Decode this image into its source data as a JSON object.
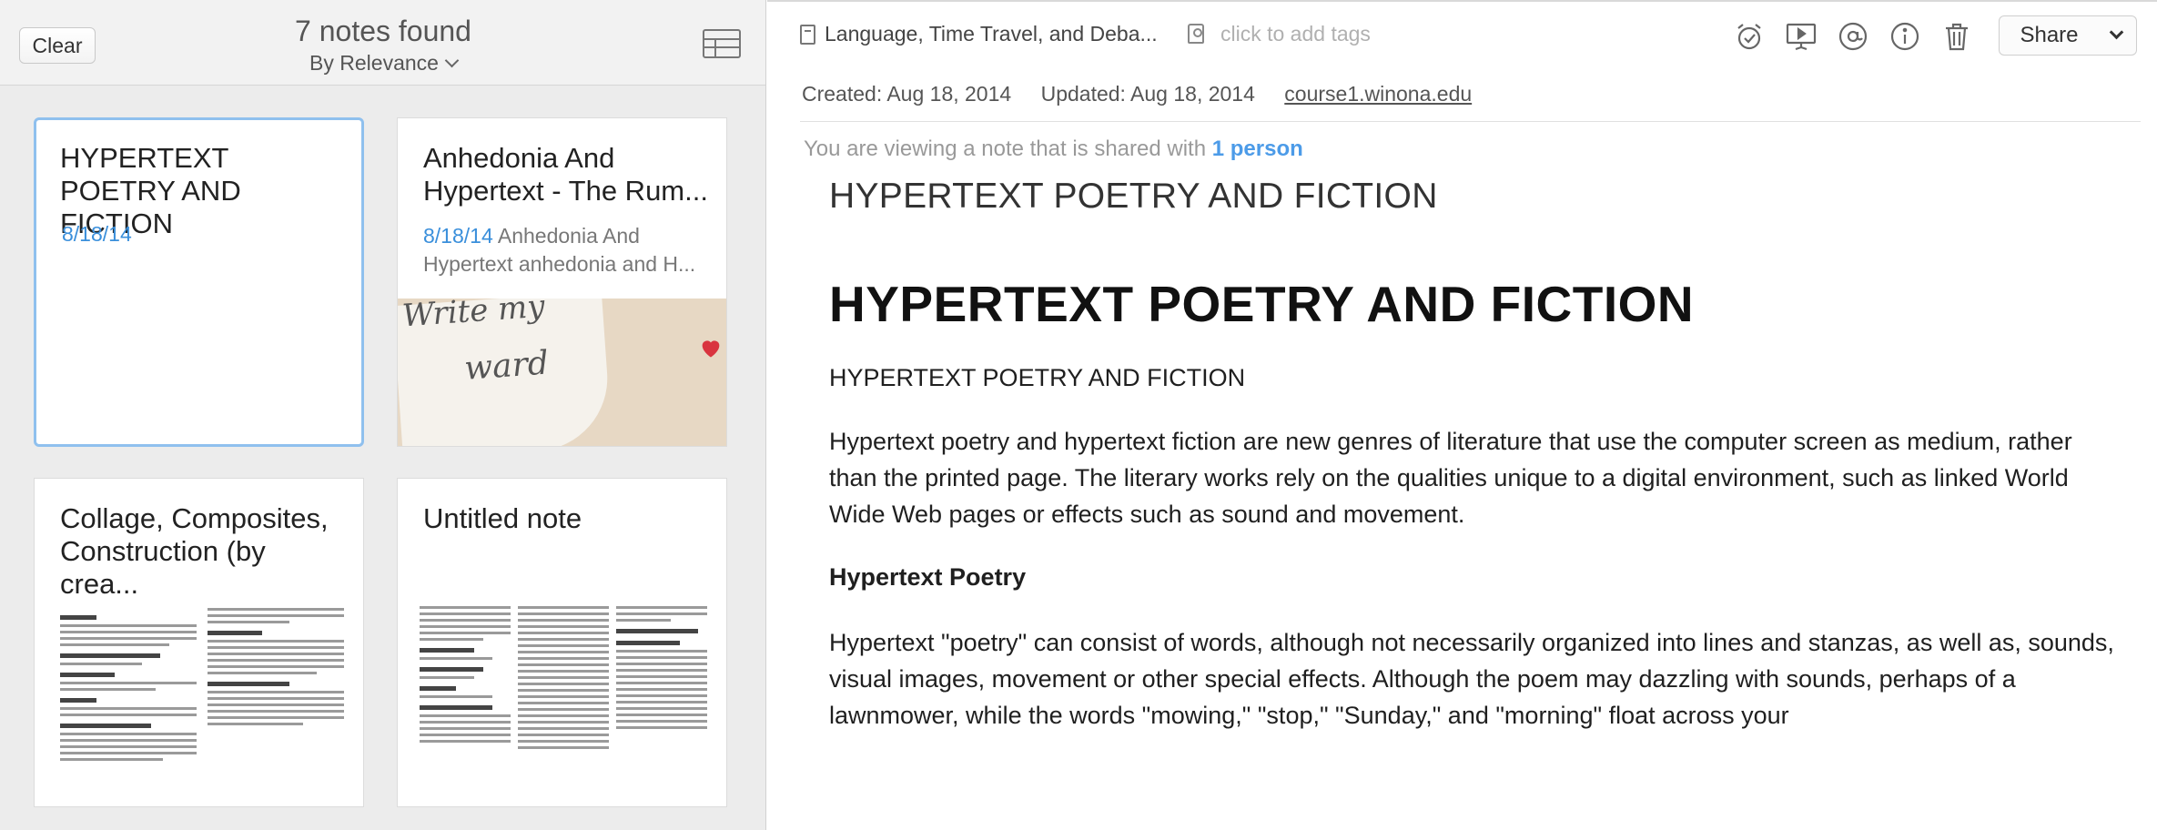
{
  "left_pane": {
    "clear_label": "Clear",
    "count_title": "7 notes found",
    "sort_label": "By Relevance",
    "cards": [
      {
        "title": "HYPERTEXT POETRY AND FICTION",
        "date": "8/18/14",
        "snippet": ""
      },
      {
        "title": "Anhedonia And Hypertext - The Rum...",
        "date": "8/18/14",
        "snippet": " Anhedonia And Hypertext anhedonia and H...",
        "thumb_text_1": "Write my",
        "thumb_text_2": "ward"
      },
      {
        "title": "Collage, Composites, Construction (by crea...",
        "date": "",
        "snippet": ""
      },
      {
        "title": "Untitled note",
        "date": "",
        "snippet": ""
      }
    ]
  },
  "header": {
    "notebook": "Language, Time Travel, and Deba...",
    "tags_placeholder": "click to add tags",
    "share_label": "Share",
    "tools": [
      "reminder-icon",
      "presentation-icon",
      "mention-icon",
      "info-icon",
      "trash-icon"
    ]
  },
  "meta": {
    "created": "Created: Aug 18, 2014",
    "updated": "Updated: Aug 18, 2014",
    "source_link": "course1.winona.edu"
  },
  "shared": {
    "prefix": "You are viewing a note that is shared with ",
    "people": "1 person"
  },
  "note": {
    "title": "HYPERTEXT POETRY AND FICTION",
    "heading": "HYPERTEXT POETRY AND FICTION",
    "subheading": "HYPERTEXT POETRY AND FICTION",
    "paragraph1": "Hypertext poetry and hypertext fiction are new genres of literature that use the computer screen as medium, rather than the printed page. The literary works rely on the qualities unique to a digital environment, such as linked World Wide Web pages or effects such as sound and movement.",
    "section_heading": "Hypertext Poetry",
    "paragraph2": "Hypertext \"poetry\" can consist of words, although not necessarily organized into lines and stanzas, as well as, sounds, visual images, movement or other special effects. Although the poem may dazzling with sounds, perhaps of a lawnmower, while the words \"mowing,\" \"stop,\" \"Sunday,\" and \"morning\" float across your"
  },
  "colors": {
    "accent": "#3a8fdb",
    "selection_border": "#8fc0ee",
    "shared_link": "#4c9be8",
    "heart": "#d9343f"
  }
}
